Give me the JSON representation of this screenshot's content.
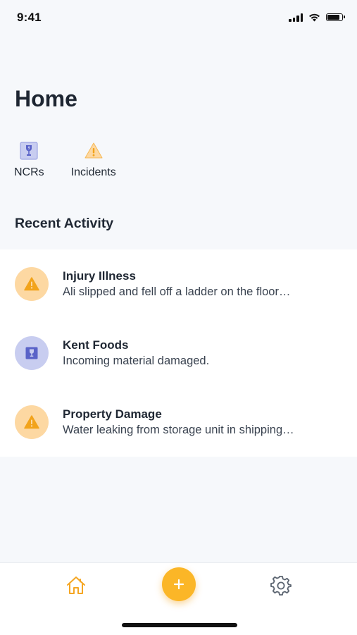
{
  "status_bar": {
    "time": "9:41"
  },
  "header": {
    "title": "Home"
  },
  "shortcuts": [
    {
      "label": "NCRs",
      "icon": "fragile-box-icon"
    },
    {
      "label": "Incidents",
      "icon": "warning-icon"
    }
  ],
  "recent_activity": {
    "title": "Recent Activity",
    "items": [
      {
        "title": "Injury Illness",
        "subtitle": "Ali slipped and fell off a ladder on the floor…",
        "icon": "warning-icon",
        "type": "incident"
      },
      {
        "title": "Kent Foods",
        "subtitle": "Incoming material damaged.",
        "icon": "fragile-box-icon",
        "type": "ncr"
      },
      {
        "title": "Property Damage",
        "subtitle": "Water leaking from storage unit in shipping…",
        "icon": "warning-icon",
        "type": "incident"
      }
    ]
  },
  "bottom_nav": {
    "items": [
      "home-icon",
      "add-icon",
      "gear-icon"
    ],
    "active": "home"
  },
  "colors": {
    "accent": "#fbb627",
    "incident_bg": "#fdd8a2",
    "ncr_bg": "#c8cdf0",
    "ncr_icon": "#5a63c8",
    "warning_icon": "#f2a31b"
  }
}
